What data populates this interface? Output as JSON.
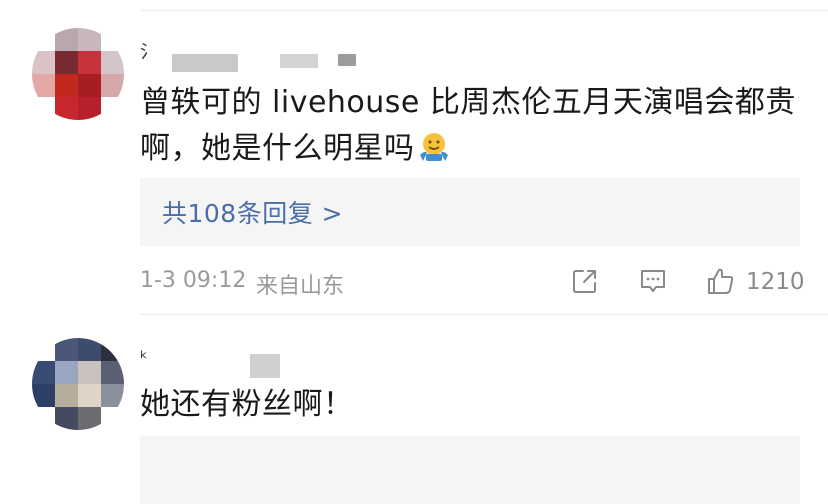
{
  "comments": [
    {
      "username_visible": "氵",
      "text_line1": "曾轶可的 livehouse 比周杰伦五月天演唱会都贵",
      "text_line2": "啊，她是什么明星吗",
      "emoji": "shrug-emoji",
      "replies_label": "共108条回复 >",
      "time": "1-3 09:12",
      "location": "来自山东",
      "like_count": "1210"
    },
    {
      "username_visible": "ᵏ",
      "text_line1": "她还有粉丝啊！"
    }
  ],
  "icons": {
    "share": "share-icon",
    "reply": "comment-icon",
    "like": "thumbs-up-icon"
  },
  "colors": {
    "link": "#4a6ea9",
    "meta_gray": "#9a9a9a",
    "reply_box_bg": "#f5f5f5"
  }
}
